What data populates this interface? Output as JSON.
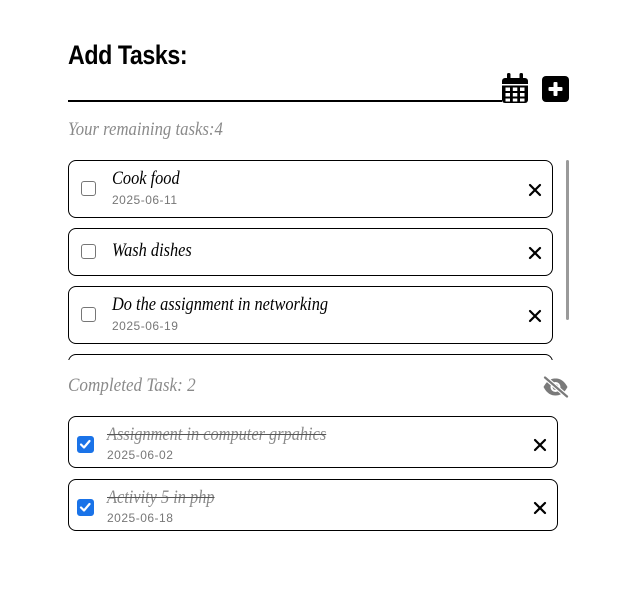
{
  "header": {
    "title": "Add Tasks:",
    "input_value": "",
    "calendar_icon": "calendar-icon",
    "add_icon": "plus-square-icon"
  },
  "pending": {
    "label": "Your remaining tasks:",
    "count": "4",
    "tasks": [
      {
        "name": "Cook food",
        "date": "2025-06-11",
        "checked": false
      },
      {
        "name": "Wash dishes",
        "date": "",
        "checked": false
      },
      {
        "name": "Do the assignment in networking",
        "date": "2025-06-19",
        "checked": false
      },
      {
        "name": "",
        "date": "",
        "checked": false
      }
    ]
  },
  "completed": {
    "label": "Completed Task: 2",
    "toggle_icon": "eye-slash-icon",
    "tasks": [
      {
        "name": "Assignment in computer grpahics",
        "date": "2025-06-02",
        "checked": true
      },
      {
        "name": "Activity 5 in php",
        "date": "2025-06-18",
        "checked": true
      }
    ]
  },
  "colors": {
    "accent": "#1a73e8",
    "muted_text": "#8a8a8a",
    "border": "#000000"
  }
}
